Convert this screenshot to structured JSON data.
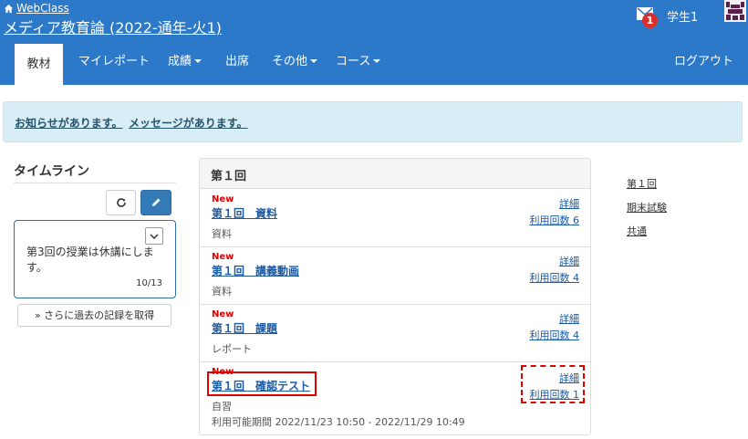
{
  "header": {
    "home_label": "WebClass",
    "course_title": "メディア教育論 (2022-通年-火1)",
    "mail_badge": "1",
    "user_name": "学生1"
  },
  "nav": {
    "items": [
      {
        "label": "教材",
        "active": true
      },
      {
        "label": "マイレポート"
      },
      {
        "label": "成績"
      },
      {
        "label": "出席"
      },
      {
        "label": "その他"
      },
      {
        "label": "コース"
      }
    ],
    "logout": "ログアウト"
  },
  "notice": {
    "info_link": "お知らせがあります。",
    "message_link": "メッセージがあります。"
  },
  "timeline": {
    "heading": "タイムライン",
    "entry_text": "第3回の授業は休講にします。",
    "entry_date": "10/13",
    "more_button": "» さらに過去の記録を取得"
  },
  "panel": {
    "title": "第１回",
    "items": [
      {
        "new": "New",
        "title": "第１回　資料",
        "type": "資料",
        "detail": "詳細",
        "usage": "利用回数 6"
      },
      {
        "new": "New",
        "title": "第１回　講義動画",
        "type": "資料",
        "detail": "詳細",
        "usage": "利用回数 4"
      },
      {
        "new": "New",
        "title": "第１回　課題",
        "type": "レポート",
        "detail": "詳細",
        "usage": "利用回数 4"
      },
      {
        "new": "New",
        "title": "第１回　確認テスト",
        "type": "自習",
        "detail": "詳細",
        "usage": "利用回数 1",
        "period": "利用可能期間  2022/11/23 10:50 - 2022/11/29 10:49"
      }
    ]
  },
  "side_links": [
    "第１回",
    "期末試験",
    "共通"
  ],
  "colors": {
    "header_blue": "#2c78c9",
    "notice_bg": "#d9edf7",
    "highlight_red": "#e00000",
    "link_blue": "#1a5aa6"
  }
}
